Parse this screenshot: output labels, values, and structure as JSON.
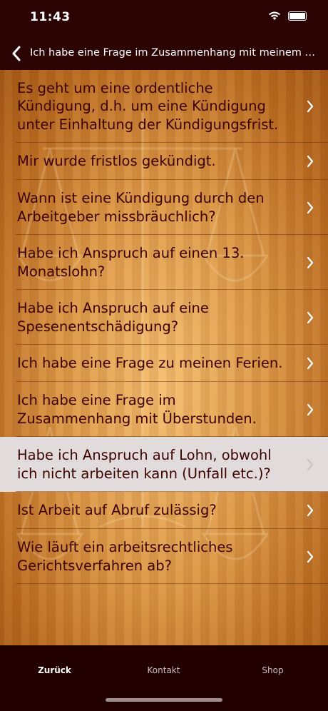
{
  "status_bar": {
    "time": "11:43"
  },
  "nav": {
    "title": "Ich habe eine Frage im Zusammenhang mit meinem Arbeitsverhältnis."
  },
  "list": {
    "items": [
      {
        "label": "Es geht um eine ordentliche Kündigung, d.h. um eine Kündigung unter Einhaltung der Kündigungsfrist."
      },
      {
        "label": "Mir wurde fristlos gekündigt."
      },
      {
        "label": "Wann ist eine Kündigung durch den Arbeitgeber missbräuchlich?"
      },
      {
        "label": "Habe ich Anspruch auf einen 13. Monatslohn?"
      },
      {
        "label": "Habe ich Anspruch auf eine Spesenentschädigung?"
      },
      {
        "label": "Ich habe eine Frage zu meinen Ferien."
      },
      {
        "label": "Ich habe eine Frage im Zusammenhang mit Überstunden."
      },
      {
        "label": "Habe ich Anspruch auf Lohn, obwohl ich nicht arbeiten kann (Unfall etc.)?"
      },
      {
        "label": "Ist Arbeit auf Abruf zulässig?"
      },
      {
        "label": "Wie läuft ein arbeitsrechtliches Gerichtsverfahren ab?"
      }
    ],
    "selected_index": 7
  },
  "tabs": [
    {
      "label": "Zurück"
    },
    {
      "label": "Kontakt"
    },
    {
      "label": "Shop"
    }
  ],
  "colors": {
    "header_bg": "#2b0303",
    "item_text": "#3c0202",
    "selected_row": "#e1dcdb",
    "tabbar_bg": "#220000"
  }
}
